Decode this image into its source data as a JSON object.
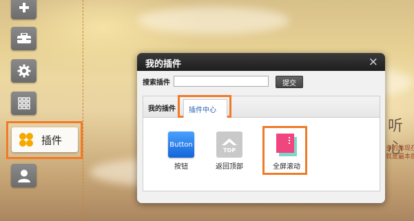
{
  "sidebar": {
    "plugin_label": "插件"
  },
  "background": {
    "right_text_large": "听心",
    "right_text_line1": "多的体现在",
    "right_text_line2": "就是最本质"
  },
  "dialog": {
    "title": "我的插件",
    "close_icon": "×",
    "search": {
      "label": "搜索插件",
      "value": "",
      "placeholder": "",
      "submit_label": "提交"
    },
    "tabs": [
      {
        "label": "我的插件"
      },
      {
        "label": "插件中心"
      }
    ],
    "plugins": [
      {
        "label": "按钮",
        "icon_text": "Button",
        "icon": "button-icon"
      },
      {
        "label": "返回顶部",
        "icon_text": "TOP",
        "icon": "back-to-top-icon"
      },
      {
        "label": "全屏滚动",
        "icon": "fullscreen-scroll-icon"
      }
    ]
  },
  "colors": {
    "highlight": "#f07a26",
    "dialog_header": "#2a2a2a",
    "tab_active_text": "#2a5fb0",
    "button_icon": "#1e7be8",
    "scroll_icon_pink": "#f0457e",
    "scroll_icon_teal": "#7fd6c8"
  }
}
